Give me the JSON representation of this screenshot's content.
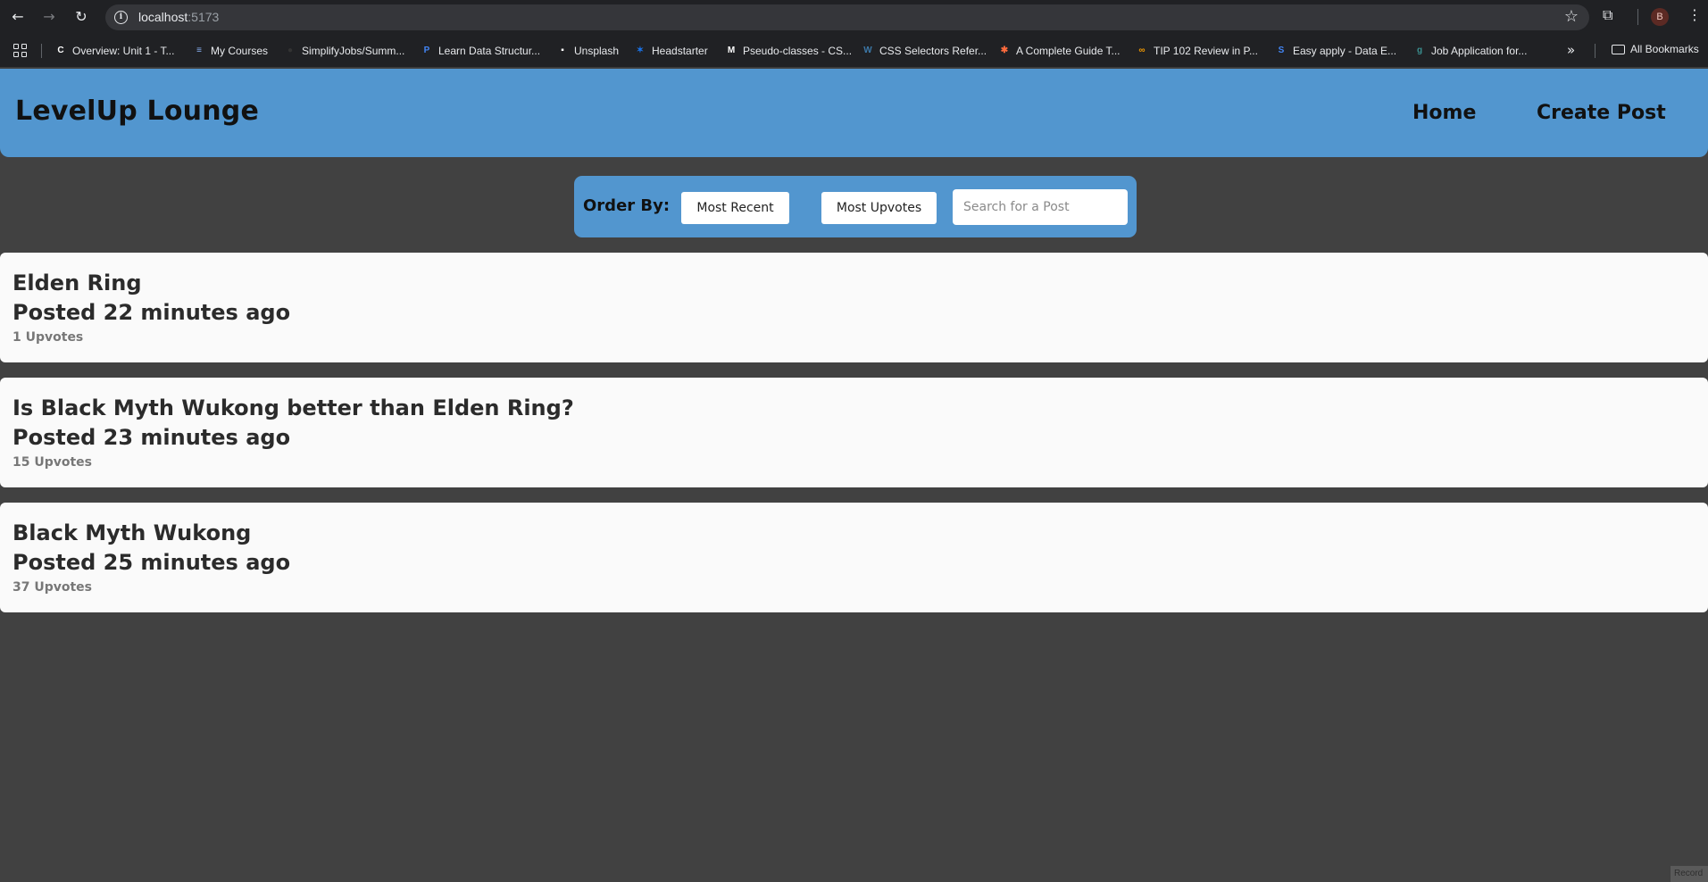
{
  "browser": {
    "url_host": "localhost",
    "url_port": ":5173",
    "profile_initial": "B",
    "bookmarks": [
      {
        "label": "Overview: Unit 1 - T...",
        "icon": "C",
        "color": "#ffffff"
      },
      {
        "label": "My Courses",
        "icon": "≡",
        "color": "#8ab4f8"
      },
      {
        "label": "SimplifyJobs/Summ...",
        "icon": "●",
        "color": "#333333"
      },
      {
        "label": "Learn Data Structur...",
        "icon": "P",
        "color": "#4285f4"
      },
      {
        "label": "Unsplash",
        "icon": "▪",
        "color": "#ffffff"
      },
      {
        "label": "Headstarter",
        "icon": "✶",
        "color": "#1a73e8"
      },
      {
        "label": "Pseudo-classes - CS...",
        "icon": "M",
        "color": "#ffffff"
      },
      {
        "label": "CSS Selectors Refer...",
        "icon": "W",
        "color": "#3c78a8"
      },
      {
        "label": "A Complete Guide T...",
        "icon": "✱",
        "color": "#ff6b3d"
      },
      {
        "label": "TIP 102 Review in P...",
        "icon": "∞",
        "color": "#f29900"
      },
      {
        "label": "Easy apply - Data E...",
        "icon": "S",
        "color": "#4285f4"
      },
      {
        "label": "Job Application for...",
        "icon": "g",
        "color": "#3a8f8f"
      }
    ],
    "all_bookmarks_label": "All Bookmarks"
  },
  "header": {
    "title": "LevelUp Lounge",
    "nav": {
      "home": "Home",
      "create_post": "Create Post"
    }
  },
  "order_bar": {
    "label": "Order By:",
    "most_recent": "Most Recent",
    "most_upvotes": "Most Upvotes",
    "search_placeholder": "Search for a Post"
  },
  "posts": [
    {
      "title": "Elden Ring",
      "time": "Posted 22 minutes ago",
      "upvotes": "1 Upvotes"
    },
    {
      "title": "Is Black Myth Wukong better than Elden Ring?",
      "time": "Posted 23 minutes ago",
      "upvotes": "15 Upvotes"
    },
    {
      "title": "Black Myth Wukong",
      "time": "Posted 25 minutes ago",
      "upvotes": "37 Upvotes"
    }
  ],
  "corner_badge": "Record",
  "colors": {
    "accent": "#5296cf",
    "background": "#414141",
    "card": "#fafafa"
  }
}
